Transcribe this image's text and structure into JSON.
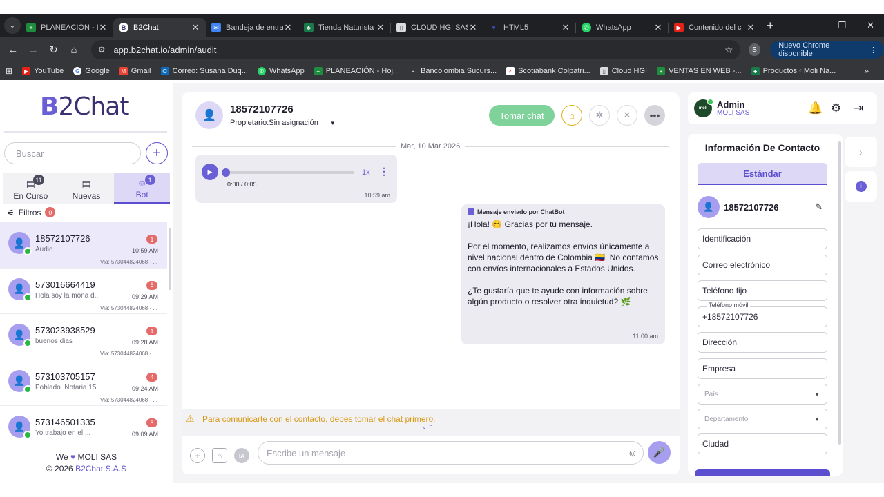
{
  "browser": {
    "tabs": [
      {
        "title": "PLANEACIÓN - I",
        "favicon": "sheets-icon",
        "color": "#1e8e3e"
      },
      {
        "title": "B2Chat",
        "favicon": "b2chat-icon",
        "color": "#3b3170",
        "active": true
      },
      {
        "title": "Bandeja de entra",
        "favicon": "mail-icon",
        "color": "#4285f4"
      },
      {
        "title": "Tienda Naturista",
        "favicon": "leaf-icon",
        "color": "#1a7a4a"
      },
      {
        "title": "CLOUD HGI SAS",
        "favicon": "doc-icon",
        "color": "#9aa0a6"
      },
      {
        "title": "HTML5",
        "favicon": "html5-icon",
        "color": "#1f2023"
      },
      {
        "title": "WhatsApp",
        "favicon": "whatsapp-icon",
        "color": "#25d366"
      },
      {
        "title": "Contenido del c",
        "favicon": "youtube-icon",
        "color": "#e62117"
      }
    ],
    "url": "app.b2chat.io/admin/audit",
    "profile_initial": "S",
    "update_label": "Nuevo Chrome disponible",
    "bookmarks": [
      {
        "label": "YouTube",
        "icon": "youtube-icon",
        "color": "#e62117"
      },
      {
        "label": "Google",
        "icon": "google-icon",
        "color": "#4285f4"
      },
      {
        "label": "Gmail",
        "icon": "gmail-icon",
        "color": "#ea4335"
      },
      {
        "label": "Correo: Susana Duq...",
        "icon": "outlook-icon",
        "color": "#0f6cbd"
      },
      {
        "label": "WhatsApp",
        "icon": "whatsapp-icon",
        "color": "#25d366"
      },
      {
        "label": "PLANEACIÓN - Hoj...",
        "icon": "sheets-icon",
        "color": "#1e8e3e"
      },
      {
        "label": "Bancolombia Sucurs...",
        "icon": "bank-icon",
        "color": "#f5f5f5"
      },
      {
        "label": "Scotiabank Colpatri...",
        "icon": "scotia-icon",
        "color": "#ec111a"
      },
      {
        "label": "Cloud HGI",
        "icon": "doc-icon",
        "color": "#9aa0a6"
      },
      {
        "label": "VENTAS EN WEB -...",
        "icon": "sheets-icon",
        "color": "#1e8e3e"
      },
      {
        "label": "Productos ‹ Moli Na...",
        "icon": "leaf-icon",
        "color": "#1a7a4a"
      }
    ]
  },
  "sidebar": {
    "logo_b": "B",
    "logo_rest": "2Chat",
    "search_placeholder": "Buscar",
    "tabs": [
      {
        "label": "En Curso",
        "count": "11"
      },
      {
        "label": "Nuevas",
        "count": ""
      },
      {
        "label": "Bot",
        "count": "1",
        "active": true
      }
    ],
    "filters_label": "Filtros",
    "filters_count": "0",
    "conversations": [
      {
        "name": "18572107726",
        "preview": "Audio",
        "unread": "1",
        "time": "10:59 AM",
        "via": "Via: 573044824068 - ...",
        "selected": true
      },
      {
        "name": "573016664419",
        "preview": "Hola soy la mona d...",
        "unread": "6",
        "time": "09:29 AM",
        "via": "Via: 573044824068 - ..."
      },
      {
        "name": "573023938529",
        "preview": "buenos dias",
        "unread": "1",
        "time": "09:28 AM",
        "via": "Via: 573044824068 - ..."
      },
      {
        "name": "573103705157",
        "preview": "Poblado. Notaria 15",
        "unread": "4",
        "time": "09:24 AM",
        "via": "Via: 573044824068 - ..."
      },
      {
        "name": "573146501335",
        "preview": "Yo trabajo en el ...",
        "unread": "5",
        "time": "09:09 AM",
        "via": ""
      }
    ],
    "footer_we": "We",
    "footer_company": "MOLI SAS",
    "footer_copy": "© 2026",
    "footer_link": "B2Chat S.A.S"
  },
  "chat": {
    "phone": "18572107726",
    "owner_label": "Propietario:",
    "owner_value": "Sin asignación",
    "take_label": "Tomar chat",
    "date": "Mar, 10 Mar 2026",
    "audio": {
      "time": "0:00 / 0:05",
      "speed": "1x",
      "stamp": "10:59 am"
    },
    "bot_header": "Mensaje enviado por ChatBot",
    "bot_text": "¡Hola! 😊 Gracias por tu mensaje.\n\nPor el momento, realizamos envíos únicamente a nivel nacional dentro de Colombia 🇨🇴. No contamos con envíos internacionales a Estados Unidos.\n\n¿Te gustaría que te ayude con información sobre algún producto o resolver otra inquietud? 🌿",
    "bot_stamp": "11:00 am",
    "warning": "Para comunicarte con el contacto, debes tomar el chat primero.",
    "input_placeholder": "Escribe un mensaje",
    "ia_label": "IA"
  },
  "admin": {
    "name": "Admin",
    "company": "MOLI SAS",
    "avatar_text": "moli"
  },
  "contact": {
    "title": "Información De Contacto",
    "tab": "Estándar",
    "phone": "18572107726",
    "fields": {
      "id": "Identificación",
      "email": "Correo electrónico",
      "landline": "Teléfono fijo",
      "mobile_label": "Teléfono móvil",
      "mobile_value": "+18572107726",
      "address": "Dirección",
      "company": "Empresa",
      "country": "País",
      "department": "Departamento",
      "city": "Ciudad"
    }
  },
  "colors": {
    "brand": "#5b4fcf",
    "take_chat": "#7ed29a",
    "warning": "#d99a18",
    "unread": "#e56a6a"
  }
}
